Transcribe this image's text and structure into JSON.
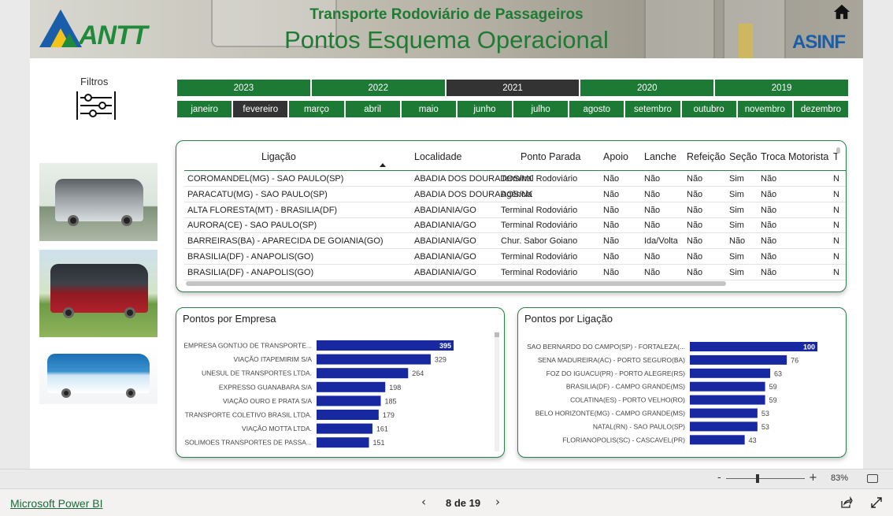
{
  "header": {
    "subtitle": "Transporte Rodoviário de Passageiros",
    "title": "Pontos Esquema Operacional",
    "logo_left": "ANTT",
    "logo_right": "ASINF",
    "home_icon": "home-icon"
  },
  "filters": {
    "label": "Filtros",
    "icon": "sliders-icon"
  },
  "years": {
    "items": [
      "2023",
      "2022",
      "2021",
      "2020",
      "2019"
    ],
    "selected": "2021"
  },
  "months": {
    "items": [
      "janeiro",
      "fevereiro",
      "março",
      "abril",
      "maio",
      "junho",
      "julho",
      "agosto",
      "setembro",
      "outubro",
      "novembro",
      "dezembro"
    ],
    "selected": "fevereiro"
  },
  "table": {
    "columns": [
      "Ligação",
      "Localidade",
      "Ponto Parada",
      "Apoio",
      "Lanche",
      "Refeição",
      "Seção",
      "Troca Motorista",
      "T"
    ],
    "rows": [
      [
        "COROMANDEL(MG) - SAO PAULO(SP)",
        "ABADIA DOS DOURADOS/MG",
        "Terminal Rodoviário",
        "Não",
        "Não",
        "Não",
        "Sim",
        "Não",
        "N"
      ],
      [
        "PARACATU(MG) - SAO PAULO(SP)",
        "ABADIA DOS DOURADOS/MG",
        "Agência",
        "Não",
        "Não",
        "Não",
        "Sim",
        "Não",
        "N"
      ],
      [
        "ALTA FLORESTA(MT) - BRASILIA(DF)",
        "ABADIANIA/GO",
        "Terminal Rodoviário",
        "Não",
        "Não",
        "Não",
        "Sim",
        "Não",
        "N"
      ],
      [
        "AURORA(CE) - SAO PAULO(SP)",
        "ABADIANIA/GO",
        "Terminal Rodoviário",
        "Não",
        "Não",
        "Não",
        "Sim",
        "Não",
        "N"
      ],
      [
        "BARREIRAS(BA) - APARECIDA DE GOIANIA(GO)",
        "ABADIANIA/GO",
        "Chur. Sabor Goiano",
        "Não",
        "Ida/Volta",
        "Não",
        "Não",
        "Não",
        "N"
      ],
      [
        "BRASILIA(DF) - ANAPOLIS(GO)",
        "ABADIANIA/GO",
        "Terminal Rodoviário",
        "Não",
        "Não",
        "Não",
        "Sim",
        "Não",
        "N"
      ],
      [
        "BRASILIA(DF) - ANAPOLIS(GO)",
        "ABADIANIA/GO",
        "Terminal Rodoviário",
        "Não",
        "Não",
        "Não",
        "Sim",
        "Não",
        "N"
      ]
    ]
  },
  "chart_data": [
    {
      "type": "bar",
      "orientation": "horizontal",
      "title": "Pontos por Empresa",
      "categories": [
        "EMPRESA GONTIJO DE TRANSPORTE...",
        "VIAÇÃO ITAPEMIRIM S/A",
        "UNESUL DE TRANSPORTES LTDA.",
        "EXPRESSO GUANABARA S/A",
        "VIAÇÃO OURO E PRATA S/A",
        "TRANSPORTE COLETIVO BRASIL LTDA.",
        "VIAÇÃO MOTTA LTDA.",
        "SOLIMOES TRANSPORTES DE PASSA..."
      ],
      "values": [
        395,
        329,
        264,
        198,
        185,
        179,
        161,
        151
      ],
      "xlim": [
        0,
        395
      ],
      "color": "#1728a0",
      "data_labels": true
    },
    {
      "type": "bar",
      "orientation": "horizontal",
      "title": "Pontos por Ligação",
      "categories": [
        "SAO BERNARDO DO CAMPO(SP) - FORTALEZA(...",
        "SENA MADUREIRA(AC) - PORTO SEGURO(BA)",
        "FOZ DO IGUACU(PR) - PORTO ALEGRE(RS)",
        "BRASILIA(DF) - CAMPO GRANDE(MS)",
        "COLATINA(ES) - PORTO VELHO(RO)",
        "BELO HORIZONTE(MG) - CAMPO GRANDE(MS)",
        "NATAL(RN) - SAO PAULO(SP)",
        "FLORIANOPOLIS(SC) - CASCAVEL(PR)"
      ],
      "values": [
        100,
        76,
        63,
        59,
        59,
        53,
        53,
        43
      ],
      "xlim": [
        0,
        100
      ],
      "color": "#1728a0",
      "data_labels": true
    }
  ],
  "zoom": {
    "minus": "-",
    "plus": "+",
    "percent": "83%",
    "level": 0.83
  },
  "footer": {
    "link": "Microsoft Power BI",
    "page": "8 de 19",
    "prev": "‹",
    "next": "›"
  }
}
